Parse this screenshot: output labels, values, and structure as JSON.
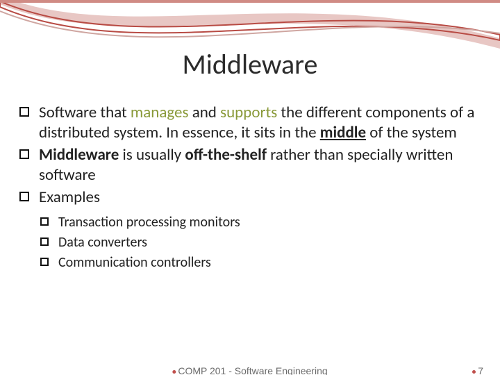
{
  "title": "Middleware",
  "bullets": [
    {
      "level": 1,
      "runs": [
        {
          "t": "Software that "
        },
        {
          "t": "manages",
          "cls": "hl-green"
        },
        {
          "t": " and "
        },
        {
          "t": "supports",
          "cls": "hl-green"
        },
        {
          "t": " the different components of a distributed system. In essence, it sits in the "
        },
        {
          "t": "middle",
          "cls": "bold under"
        },
        {
          "t": " of the system"
        }
      ]
    },
    {
      "level": 1,
      "runs": [
        {
          "t": "Middleware",
          "cls": "bold"
        },
        {
          "t": " is usually "
        },
        {
          "t": "off-the-shelf",
          "cls": "bold"
        },
        {
          "t": " rather than specially written software"
        }
      ]
    },
    {
      "level": 1,
      "runs": [
        {
          "t": "Examples"
        }
      ]
    },
    {
      "level": 2,
      "runs": [
        {
          "t": "Transaction processing monitors"
        }
      ]
    },
    {
      "level": 2,
      "runs": [
        {
          "t": "Data converters"
        }
      ]
    },
    {
      "level": 2,
      "runs": [
        {
          "t": "Communication controllers"
        }
      ]
    }
  ],
  "footer": {
    "center": "COMP 201 - Software Engineering",
    "page": "7"
  }
}
